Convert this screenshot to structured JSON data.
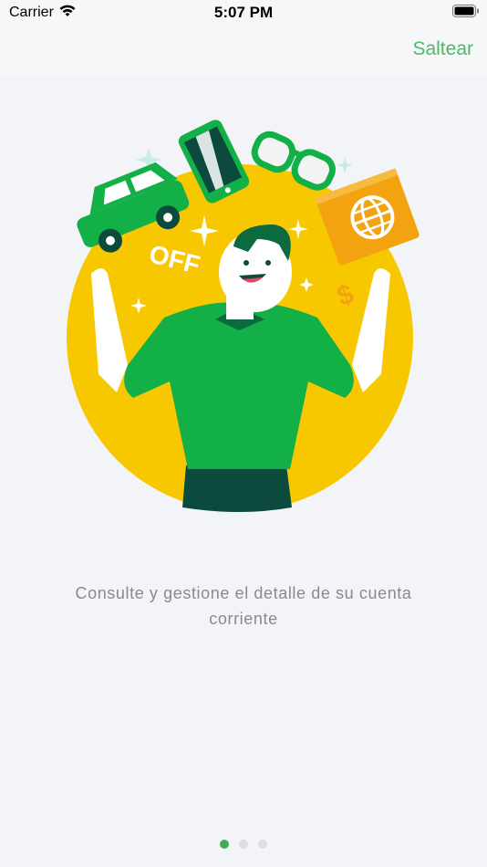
{
  "status_bar": {
    "carrier": "Carrier",
    "time": "5:07 PM"
  },
  "header": {
    "skip_label": "Saltear"
  },
  "illustration": {
    "badge_text": "OFF",
    "currency_symbol": "$"
  },
  "onboarding": {
    "caption_line1": "Consulte y gestione el detalle de su cuenta",
    "caption_line2": "corriente",
    "page_count": 3,
    "current_page": 1
  },
  "colors": {
    "accent": "#4db86a",
    "circle": "#f7c800",
    "shirt": "#12b047",
    "dark_green": "#0b4a3c"
  }
}
